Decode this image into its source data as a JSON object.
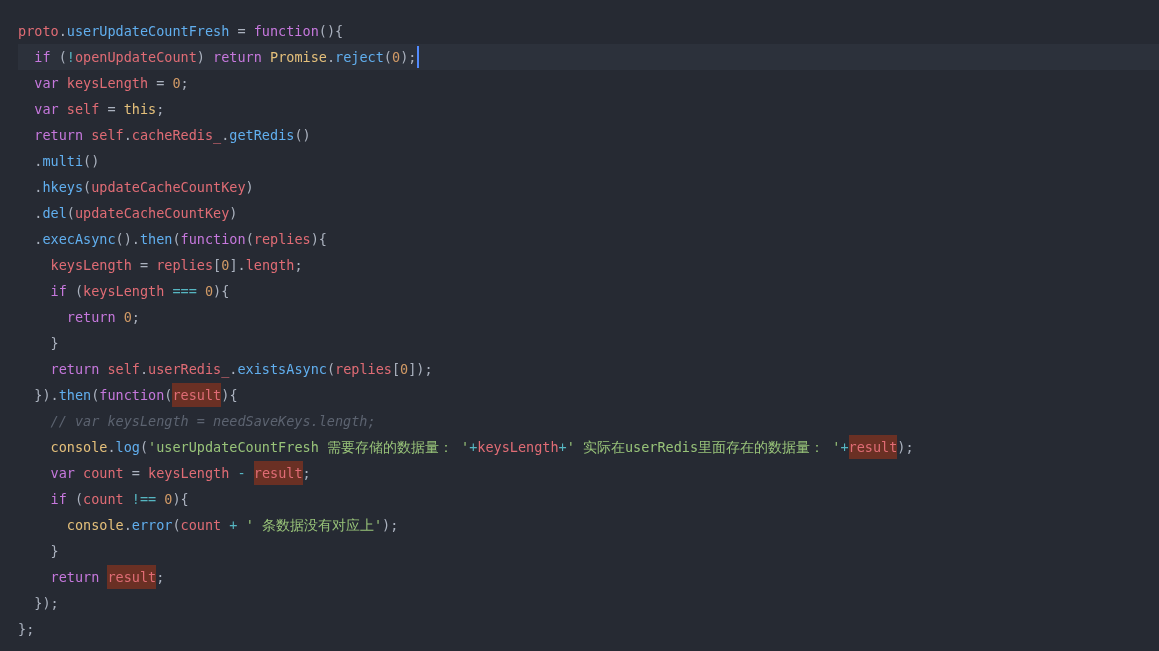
{
  "editor": {
    "lines": [
      {
        "current": false,
        "tokens": [
          {
            "kind": "var",
            "text": "proto"
          },
          {
            "kind": "p",
            "text": "."
          },
          {
            "kind": "fn",
            "text": "userUpdateCountFresh"
          },
          {
            "kind": "p",
            "text": " = "
          },
          {
            "kind": "kw",
            "text": "function"
          },
          {
            "kind": "p",
            "text": "(){"
          }
        ]
      },
      {
        "current": true,
        "tokens": [
          {
            "kind": "kw",
            "text": "  if"
          },
          {
            "kind": "p",
            "text": " ("
          },
          {
            "kind": "op",
            "text": "!"
          },
          {
            "kind": "var",
            "text": "openUpdateCount"
          },
          {
            "kind": "p",
            "text": ") "
          },
          {
            "kind": "kw",
            "text": "return"
          },
          {
            "kind": "cls",
            "text": " Promise"
          },
          {
            "kind": "p",
            "text": "."
          },
          {
            "kind": "fn",
            "text": "reject"
          },
          {
            "kind": "p",
            "text": "("
          },
          {
            "kind": "num",
            "text": "0"
          },
          {
            "kind": "p",
            "text": ");"
          }
        ]
      },
      {
        "current": false,
        "tokens": [
          {
            "kind": "kw",
            "text": "  var"
          },
          {
            "kind": "var",
            "text": " keysLength"
          },
          {
            "kind": "p",
            "text": " = "
          },
          {
            "kind": "num",
            "text": "0"
          },
          {
            "kind": "p",
            "text": ";"
          }
        ]
      },
      {
        "current": false,
        "tokens": [
          {
            "kind": "kw",
            "text": "  var"
          },
          {
            "kind": "var",
            "text": " self"
          },
          {
            "kind": "p",
            "text": " = "
          },
          {
            "kind": "cls",
            "text": "this"
          },
          {
            "kind": "p",
            "text": ";"
          }
        ]
      },
      {
        "current": false,
        "tokens": [
          {
            "kind": "kw",
            "text": "  return"
          },
          {
            "kind": "var",
            "text": " self"
          },
          {
            "kind": "p",
            "text": "."
          },
          {
            "kind": "var",
            "text": "cacheRedis_"
          },
          {
            "kind": "p",
            "text": "."
          },
          {
            "kind": "fn",
            "text": "getRedis"
          },
          {
            "kind": "p",
            "text": "()"
          }
        ]
      },
      {
        "current": false,
        "tokens": [
          {
            "kind": "p",
            "text": "  ."
          },
          {
            "kind": "fn",
            "text": "multi"
          },
          {
            "kind": "p",
            "text": "()"
          }
        ]
      },
      {
        "current": false,
        "tokens": [
          {
            "kind": "p",
            "text": "  ."
          },
          {
            "kind": "fn",
            "text": "hkeys"
          },
          {
            "kind": "p",
            "text": "("
          },
          {
            "kind": "var",
            "text": "updateCacheCountKey"
          },
          {
            "kind": "p",
            "text": ")"
          }
        ]
      },
      {
        "current": false,
        "tokens": [
          {
            "kind": "p",
            "text": "  ."
          },
          {
            "kind": "fn",
            "text": "del"
          },
          {
            "kind": "p",
            "text": "("
          },
          {
            "kind": "var",
            "text": "updateCacheCountKey"
          },
          {
            "kind": "p",
            "text": ")"
          }
        ]
      },
      {
        "current": false,
        "tokens": [
          {
            "kind": "p",
            "text": "  ."
          },
          {
            "kind": "fn",
            "text": "execAsync"
          },
          {
            "kind": "p",
            "text": "()."
          },
          {
            "kind": "fn",
            "text": "then"
          },
          {
            "kind": "p",
            "text": "("
          },
          {
            "kind": "kw",
            "text": "function"
          },
          {
            "kind": "p",
            "text": "("
          },
          {
            "kind": "var",
            "text": "replies"
          },
          {
            "kind": "p",
            "text": "){"
          }
        ]
      },
      {
        "current": false,
        "tokens": [
          {
            "kind": "var",
            "text": "    keysLength"
          },
          {
            "kind": "p",
            "text": " = "
          },
          {
            "kind": "var",
            "text": "replies"
          },
          {
            "kind": "p",
            "text": "["
          },
          {
            "kind": "num",
            "text": "0"
          },
          {
            "kind": "p",
            "text": "]."
          },
          {
            "kind": "var",
            "text": "length"
          },
          {
            "kind": "p",
            "text": ";"
          }
        ]
      },
      {
        "current": false,
        "tokens": [
          {
            "kind": "kw",
            "text": "    if"
          },
          {
            "kind": "p",
            "text": " ("
          },
          {
            "kind": "var",
            "text": "keysLength"
          },
          {
            "kind": "op",
            "text": " === "
          },
          {
            "kind": "num",
            "text": "0"
          },
          {
            "kind": "p",
            "text": "){"
          }
        ]
      },
      {
        "current": false,
        "tokens": [
          {
            "kind": "kw",
            "text": "      return"
          },
          {
            "kind": "num",
            "text": " 0"
          },
          {
            "kind": "p",
            "text": ";"
          }
        ]
      },
      {
        "current": false,
        "tokens": [
          {
            "kind": "p",
            "text": "    }"
          }
        ]
      },
      {
        "current": false,
        "tokens": [
          {
            "kind": "kw",
            "text": "    return"
          },
          {
            "kind": "var",
            "text": " self"
          },
          {
            "kind": "p",
            "text": "."
          },
          {
            "kind": "var",
            "text": "userRedis_"
          },
          {
            "kind": "p",
            "text": "."
          },
          {
            "kind": "fn",
            "text": "existsAsync"
          },
          {
            "kind": "p",
            "text": "("
          },
          {
            "kind": "var",
            "text": "replies"
          },
          {
            "kind": "p",
            "text": "["
          },
          {
            "kind": "num",
            "text": "0"
          },
          {
            "kind": "p",
            "text": "]);"
          }
        ]
      },
      {
        "current": false,
        "tokens": [
          {
            "kind": "p",
            "text": "  })."
          },
          {
            "kind": "fn",
            "text": "then"
          },
          {
            "kind": "p",
            "text": "("
          },
          {
            "kind": "kw",
            "text": "function"
          },
          {
            "kind": "p",
            "text": "("
          },
          {
            "kind": "hl",
            "text": "result"
          },
          {
            "kind": "p",
            "text": "){"
          }
        ]
      },
      {
        "current": false,
        "tokens": [
          {
            "kind": "cm",
            "text": "    // var keysLength = needSaveKeys.length;"
          }
        ]
      },
      {
        "current": false,
        "tokens": [
          {
            "kind": "cls",
            "text": "    console"
          },
          {
            "kind": "p",
            "text": "."
          },
          {
            "kind": "fn",
            "text": "log"
          },
          {
            "kind": "p",
            "text": "("
          },
          {
            "kind": "str",
            "text": "'userUpdateCountFresh 需要存储的数据量："
          },
          {
            "kind": "str",
            "text": " '"
          },
          {
            "kind": "op",
            "text": "+"
          },
          {
            "kind": "var",
            "text": "keysLength"
          },
          {
            "kind": "op",
            "text": "+"
          },
          {
            "kind": "str",
            "text": "' 实际在userRedis里面存在的数据量："
          },
          {
            "kind": "str",
            "text": " '"
          },
          {
            "kind": "op",
            "text": "+"
          },
          {
            "kind": "hl",
            "text": "result"
          },
          {
            "kind": "p",
            "text": ");"
          }
        ]
      },
      {
        "current": false,
        "tokens": [
          {
            "kind": "kw",
            "text": "    var"
          },
          {
            "kind": "var",
            "text": " count"
          },
          {
            "kind": "p",
            "text": " = "
          },
          {
            "kind": "var",
            "text": "keysLength"
          },
          {
            "kind": "op",
            "text": " - "
          },
          {
            "kind": "hl",
            "text": "result"
          },
          {
            "kind": "p",
            "text": ";"
          }
        ]
      },
      {
        "current": false,
        "tokens": [
          {
            "kind": "kw",
            "text": "    if"
          },
          {
            "kind": "p",
            "text": " ("
          },
          {
            "kind": "var",
            "text": "count"
          },
          {
            "kind": "op",
            "text": " !== "
          },
          {
            "kind": "num",
            "text": "0"
          },
          {
            "kind": "p",
            "text": "){"
          }
        ]
      },
      {
        "current": false,
        "tokens": [
          {
            "kind": "cls",
            "text": "      console"
          },
          {
            "kind": "p",
            "text": "."
          },
          {
            "kind": "fn",
            "text": "error"
          },
          {
            "kind": "p",
            "text": "("
          },
          {
            "kind": "var",
            "text": "count"
          },
          {
            "kind": "op",
            "text": " + "
          },
          {
            "kind": "str",
            "text": "' 条数据没有对应上'"
          },
          {
            "kind": "p",
            "text": ");"
          }
        ]
      },
      {
        "current": false,
        "tokens": [
          {
            "kind": "p",
            "text": "    }"
          }
        ]
      },
      {
        "current": false,
        "tokens": [
          {
            "kind": "kw",
            "text": "    return "
          },
          {
            "kind": "hl",
            "text": "result"
          },
          {
            "kind": "p",
            "text": ";"
          }
        ]
      },
      {
        "current": false,
        "tokens": [
          {
            "kind": "p",
            "text": "  });"
          }
        ]
      },
      {
        "current": false,
        "tokens": [
          {
            "kind": "p",
            "text": "};"
          }
        ]
      }
    ]
  }
}
